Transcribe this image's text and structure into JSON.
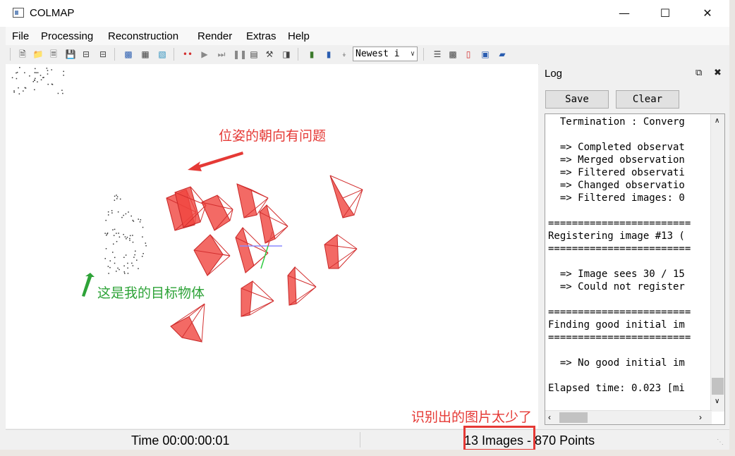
{
  "window": {
    "title": "COLMAP",
    "minimize_icon": "minimize-icon",
    "maximize_icon": "maximize-icon",
    "close_icon": "close-icon"
  },
  "menu": {
    "items": [
      "File",
      "Processing",
      "Reconstruction",
      "Render",
      "Extras",
      "Help"
    ]
  },
  "toolbar": {
    "select_value": "Newest і"
  },
  "log": {
    "title": "Log",
    "save_label": "Save",
    "clear_label": "Clear",
    "text": "  Termination : Converg\n\n  => Completed observat\n  => Merged observation\n  => Filtered observati\n  => Changed observatio\n  => Filtered images: 0\n\n========================\nRegistering image #13 (\n========================\n\n  => Image sees 30 / 15\n  => Could not register\n\n========================\nFinding good initial im\n========================\n\n  => No good initial im\n\nElapsed time: 0.023 [mi"
  },
  "statusbar": {
    "time": "Time 00:00:00:01",
    "counts": "13 Images - 870 Points"
  },
  "annotations": {
    "pose_issue": "位姿的朝向有问题",
    "target_object": "这是我的目标物体",
    "too_few_images": "识别出的图片太少了",
    "red_color": "#e53935",
    "green_color": "#2ea338"
  },
  "scene": {
    "camera_color": "#f0453f"
  }
}
